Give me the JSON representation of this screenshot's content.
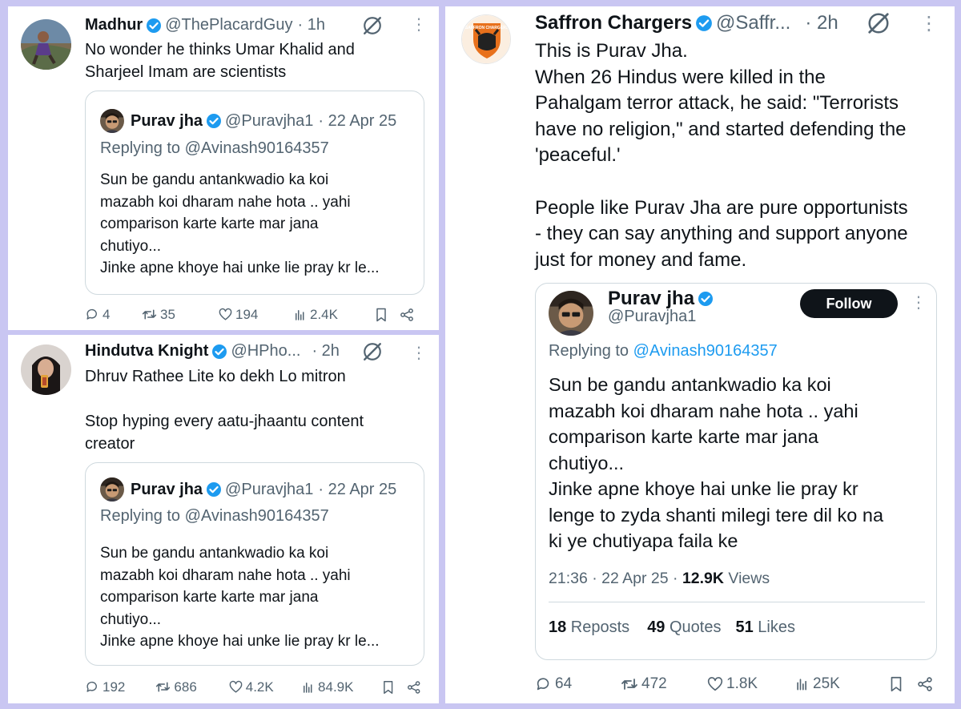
{
  "tweets": [
    {
      "name": "Madhur",
      "handle": "@ThePlacardGuy",
      "time": "· 1h",
      "text": "No wonder he thinks Umar Khalid and\nSharjeel Imam are scientists",
      "quote": {
        "name": "Purav jha",
        "handle": "@Puravjha1",
        "date": "· 22 Apr 25",
        "replying": "Replying to @Avinash90164357",
        "text": "Sun be gandu antankwadio ka koi\nmazabh koi dharam nahe hota .. yahi\ncomparison karte karte mar jana\nchutiyo...\nJinke apne khoye hai unke lie pray kr le..."
      },
      "replies": "4",
      "reposts": "35",
      "likes": "194",
      "views": "2.4K"
    },
    {
      "name": "Hindutva Knight",
      "handle": "@HPho...",
      "time": "· 2h",
      "text": "Dhruv Rathee Lite ko dekh Lo mitron\n\nStop hyping every aatu-jhaantu content\ncreator",
      "quote": {
        "name": "Purav jha",
        "handle": "@Puravjha1",
        "date": "· 22 Apr 25",
        "replying": "Replying to @Avinash90164357",
        "text": "Sun be gandu antankwadio ka koi\nmazabh koi dharam nahe hota .. yahi\ncomparison karte karte mar jana\nchutiyo...\nJinke apne khoye hai unke lie pray kr le..."
      },
      "replies": "192",
      "reposts": "686",
      "likes": "4.2K",
      "views": "84.9K"
    }
  ],
  "main": {
    "name": "Saffron Chargers",
    "handle": "@Saffr...",
    "time": "· 2h",
    "avatar_text": "SAFFRON CHARGERS",
    "text": "This is Purav Jha.\nWhen 26 Hindus were killed in the\nPahalgam terror attack, he said: \"Terrorists\nhave no religion,\" and started defending the\n'peaceful.'\n\nPeople like Purav Jha are pure opportunists\n- they can say anything and support anyone\njust for money and fame.",
    "embed": {
      "name": "Purav jha",
      "handle": "@Puravjha1",
      "follow": "Follow",
      "replying_prefix": "Replying to ",
      "replying_handle": "@Avinash90164357",
      "text": "Sun be gandu antankwadio ka koi\nmazabh koi dharam nahe hota .. yahi\ncomparison karte karte mar jana\nchutiyo...\nJinke apne khoye hai unke lie pray kr\nlenge to zyda shanti milegi tere dil ko na\nki ye chutiyapa faila ke",
      "timestamp": "21:36 · 22 Apr 25 · ",
      "views_num": "12.9K",
      "views_label": " Views",
      "reposts_num": "18",
      "reposts_label": " Reposts",
      "quotes_num": "49",
      "quotes_label": " Quotes",
      "likes_num": "51",
      "likes_label": " Likes"
    },
    "replies": "64",
    "reposts": "472",
    "likes": "1.8K",
    "views": "25K"
  },
  "colors": {
    "verified": "#1d9bf0",
    "frame": "#c9c6f2",
    "muted": "#536471"
  }
}
